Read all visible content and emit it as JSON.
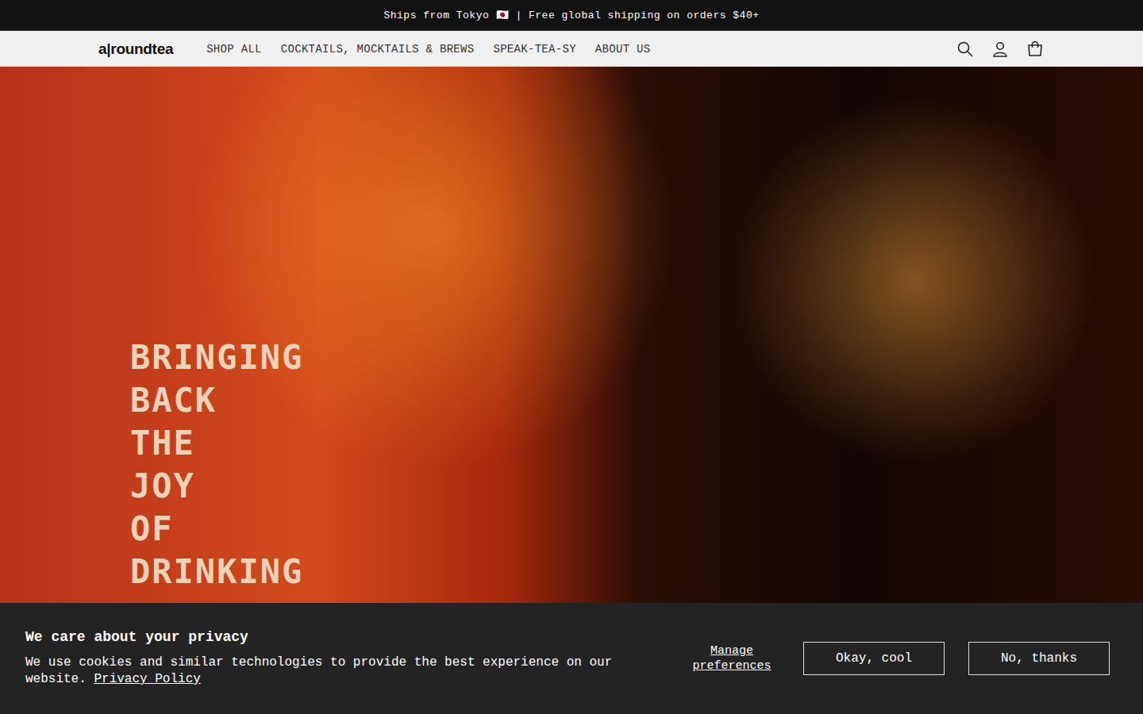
{
  "announcement": "Ships from Tokyo 🇯🇵 | Free global shipping on orders $40+",
  "header": {
    "logo": "a|roundtea",
    "nav": [
      "SHOP ALL",
      "COCKTAILS, MOCKTAILS & BREWS",
      "SPEAK-TEA-SY",
      "ABOUT US"
    ]
  },
  "hero": {
    "heading": [
      "BRINGING",
      "BACK",
      "THE",
      "JOY",
      "OF",
      "DRINKING"
    ]
  },
  "cookie_banner": {
    "title": "We care about your privacy",
    "text": "We use cookies and similar technologies to provide the best experience on our website.",
    "link": "Privacy Policy",
    "manage": "Manage preferences",
    "buttons": [
      "Okay, cool",
      "No, thanks"
    ]
  }
}
